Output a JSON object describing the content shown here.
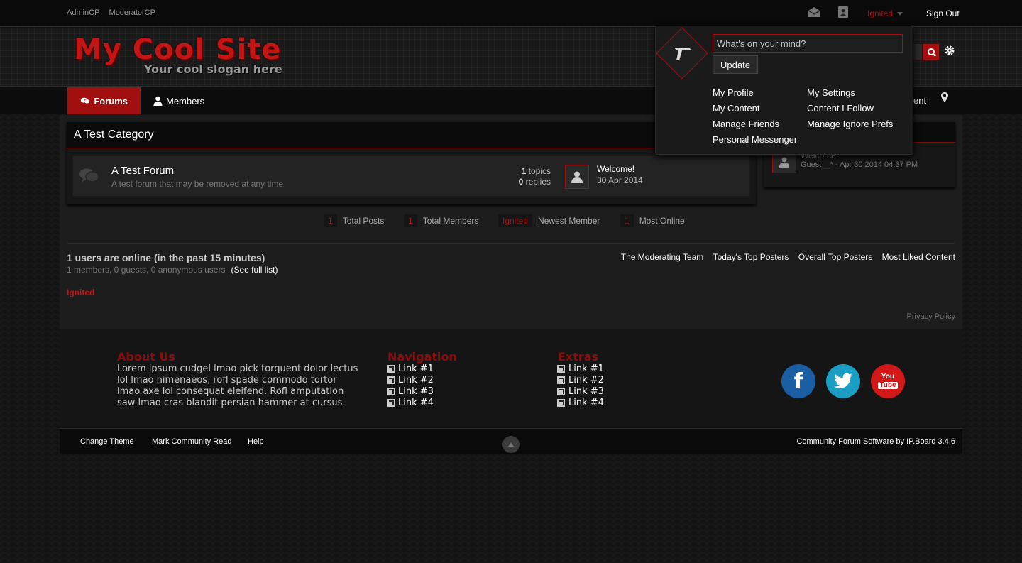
{
  "topbar": {
    "links": [
      "AdminCP",
      "ModeratorCP"
    ],
    "username": "Ignited",
    "signout": "Sign Out"
  },
  "header": {
    "title": "My Cool Site",
    "slogan": "Your cool slogan here"
  },
  "nav": {
    "tabs": [
      "Forums",
      "Members"
    ],
    "partial_label": "ent"
  },
  "category": {
    "title": "A Test Category",
    "forum": {
      "title": "A Test Forum",
      "description": "A test forum that may be removed at any time",
      "topics_count": "1",
      "topics_label": "topics",
      "replies_count": "0",
      "replies_label": "replies",
      "last_post_title": "Welcome!",
      "last_post_date": "30 Apr 2014"
    }
  },
  "sidebar": {
    "post_title": "Welcome!",
    "post_meta": "Guest__* - Apr 30 2014 04:37 PM"
  },
  "stats": [
    {
      "value": "1",
      "label": "Total Posts"
    },
    {
      "value": "1",
      "label": "Total Members"
    },
    {
      "value": "Ignited",
      "label": "Newest Member"
    },
    {
      "value": "1",
      "label": "Most Online"
    }
  ],
  "online": {
    "title": "1 users are online (in the past 15 minutes)",
    "summary": "1 members, 0 guests, 0 anonymous users",
    "full_list": "(See full list)",
    "links": [
      "The Moderating Team",
      "Today's Top Posters",
      "Overall Top Posters",
      "Most Liked Content"
    ],
    "user": "Ignited",
    "privacy": "Privacy Policy"
  },
  "footer": {
    "about_title": "About Us",
    "about_lines": [
      "Lorem ipsum cudgel lmao pick torquent dolor lectus",
      "lol lmao himenaeos, rofl spade commodo tortor",
      "lmao axe lol consequat eleifend. Rofl amputation",
      "saw lmao cras blandit persian hammer at cursus."
    ],
    "nav_title": "Navigation",
    "nav_links": [
      "Link #1",
      "Link #2",
      "Link #3",
      "Link #4"
    ],
    "extras_title": "Extras",
    "extras_links": [
      "Link #1",
      "Link #2",
      "Link #3",
      "Link #4"
    ],
    "youtube_top": "You",
    "youtube_bottom": "Tube",
    "facebook_letter": "f"
  },
  "bottombar": {
    "links": [
      "Change Theme",
      "Mark Community Read",
      "Help"
    ],
    "credit": "Community Forum Software by IP.Board 3.4.6"
  },
  "popup": {
    "status_placeholder": "What's on your mind?",
    "update_label": "Update",
    "links_left": [
      "My Profile",
      "My Content",
      "Manage Friends",
      "Personal Messenger"
    ],
    "links_right": [
      "My Settings",
      "Content I Follow",
      "Manage Ignore Prefs"
    ]
  },
  "colors": {
    "accent": "#a10f0f",
    "link_red": "#c41414",
    "background": "#141414"
  }
}
